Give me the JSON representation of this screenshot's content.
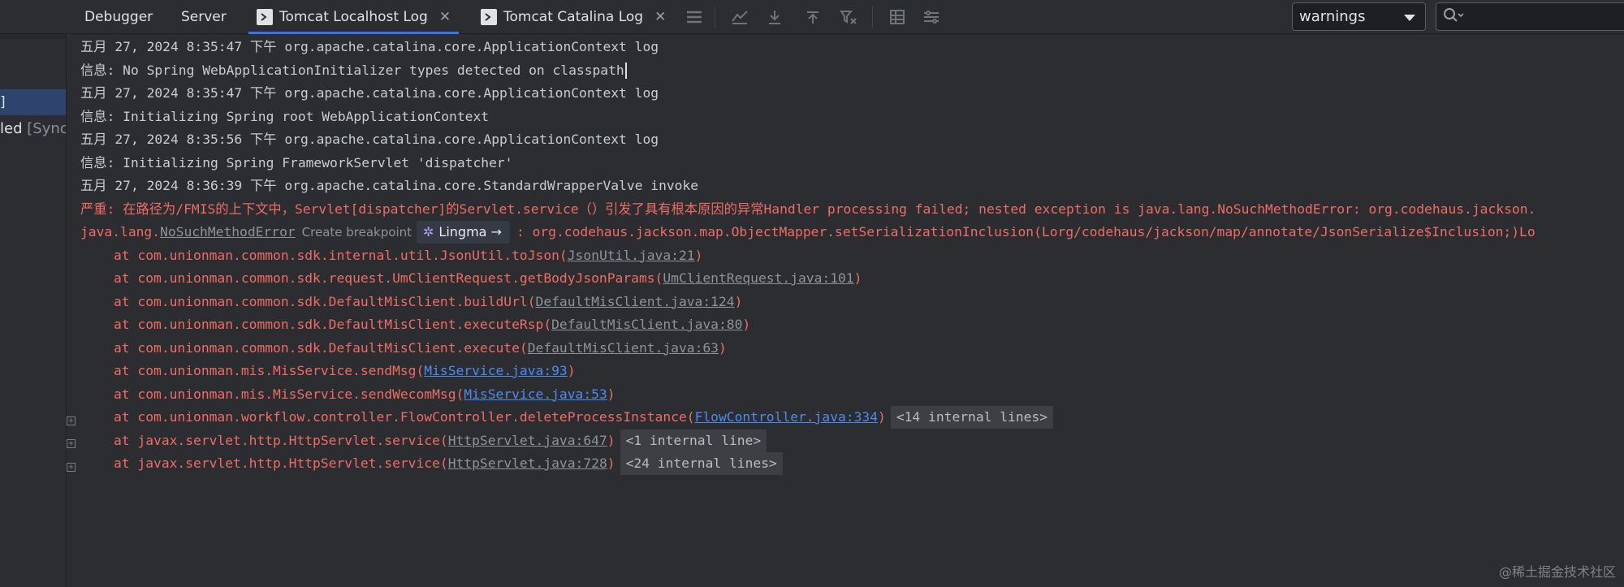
{
  "tabs": [
    {
      "label": "Debugger"
    },
    {
      "label": "Server"
    },
    {
      "label": "Tomcat Localhost Log",
      "close": "✕"
    },
    {
      "label": "Tomcat Catalina Log",
      "close": "✕"
    }
  ],
  "toolbar": {
    "icons": [
      "menu-icon",
      "softwrap-icon",
      "scroll-to-end-icon",
      "scroll-to-top-icon",
      "clear-filter-icon",
      "print-icon",
      "settings-icon"
    ]
  },
  "filter": {
    "selected": "warnings"
  },
  "search": {
    "placeholder": ""
  },
  "left_panel": {
    "selected_text": "]",
    "row2_text": "led",
    "row2_muted": "[Sync"
  },
  "console": {
    "lines": [
      "五月 27, 2024 8:35:47 下午 org.apache.catalina.core.ApplicationContext log",
      "信息: No Spring WebApplicationInitializer types detected on classpath",
      "五月 27, 2024 8:35:47 下午 org.apache.catalina.core.ApplicationContext log",
      "信息: Initializing Spring root WebApplicationContext",
      "五月 27, 2024 8:35:56 下午 org.apache.catalina.core.ApplicationContext log",
      "信息: Initializing Spring FrameworkServlet 'dispatcher'",
      "五月 27, 2024 8:36:39 下午 org.apache.catalina.core.StandardWrapperValve invoke"
    ],
    "severe_line": "严重: 在路径为/FMIS的上下文中，Servlet[dispatcher]的Servlet.service（）引发了具有根本原因的异常Handler processing failed; nested exception is java.lang.NoSuchMethodError: org.codehaus.jackson.",
    "exception": {
      "prefix": "java.lang.",
      "link": "NoSuchMethodError",
      "breakpoint_hint": "Create breakpoint",
      "lingma": "Lingma →",
      "message": ": org.codehaus.jackson.map.ObjectMapper.setSerializationInclusion(Lorg/codehaus/jackson/map/annotate/JsonSerialize$Inclusion;)Lo"
    },
    "trace": [
      {
        "text": "at com.unionman.common.sdk.internal.util.JsonUtil.toJson(",
        "link": "JsonUtil.java:21",
        "end": ")",
        "kind": "gray"
      },
      {
        "text": "at com.unionman.common.sdk.request.UmClientRequest.getBodyJsonParams(",
        "link": "UmClientRequest.java:101",
        "end": ")",
        "kind": "gray"
      },
      {
        "text": "at com.unionman.common.sdk.DefaultMisClient.buildUrl(",
        "link": "DefaultMisClient.java:124",
        "end": ")",
        "kind": "gray"
      },
      {
        "text": "at com.unionman.common.sdk.DefaultMisClient.executeRsp(",
        "link": "DefaultMisClient.java:80",
        "end": ")",
        "kind": "gray"
      },
      {
        "text": "at com.unionman.common.sdk.DefaultMisClient.execute(",
        "link": "DefaultMisClient.java:63",
        "end": ")",
        "kind": "gray"
      },
      {
        "text": "at com.unionman.mis.MisService.sendMsg(",
        "link": "MisService.java:93",
        "end": ")",
        "kind": "blue"
      },
      {
        "text": "at com.unionman.mis.MisService.sendWecomMsg(",
        "link": "MisService.java:53",
        "end": ")",
        "kind": "blue"
      },
      {
        "text": "at com.unionman.workflow.controller.FlowController.deleteProcessInstance(",
        "link": "FlowController.java:334",
        "end": ")",
        "kind": "blue",
        "internal": "<14 internal lines>"
      },
      {
        "text": "at javax.servlet.http.HttpServlet.service(",
        "link": "HttpServlet.java:647",
        "end": ")",
        "kind": "gray",
        "internal": "<1 internal line>"
      },
      {
        "text": "at javax.servlet.http.HttpServlet.service(",
        "link": "HttpServlet.java:728",
        "end": ")",
        "kind": "gray",
        "internal": "<24 internal lines>"
      }
    ]
  },
  "watermark": "@稀土掘金技术社区",
  "colors": {
    "background": "#2b2d30",
    "error_text": "#ef6c64",
    "link_blue": "#4d8bf0",
    "selection": "#2e436e",
    "accent_tab": "#3574f0"
  }
}
